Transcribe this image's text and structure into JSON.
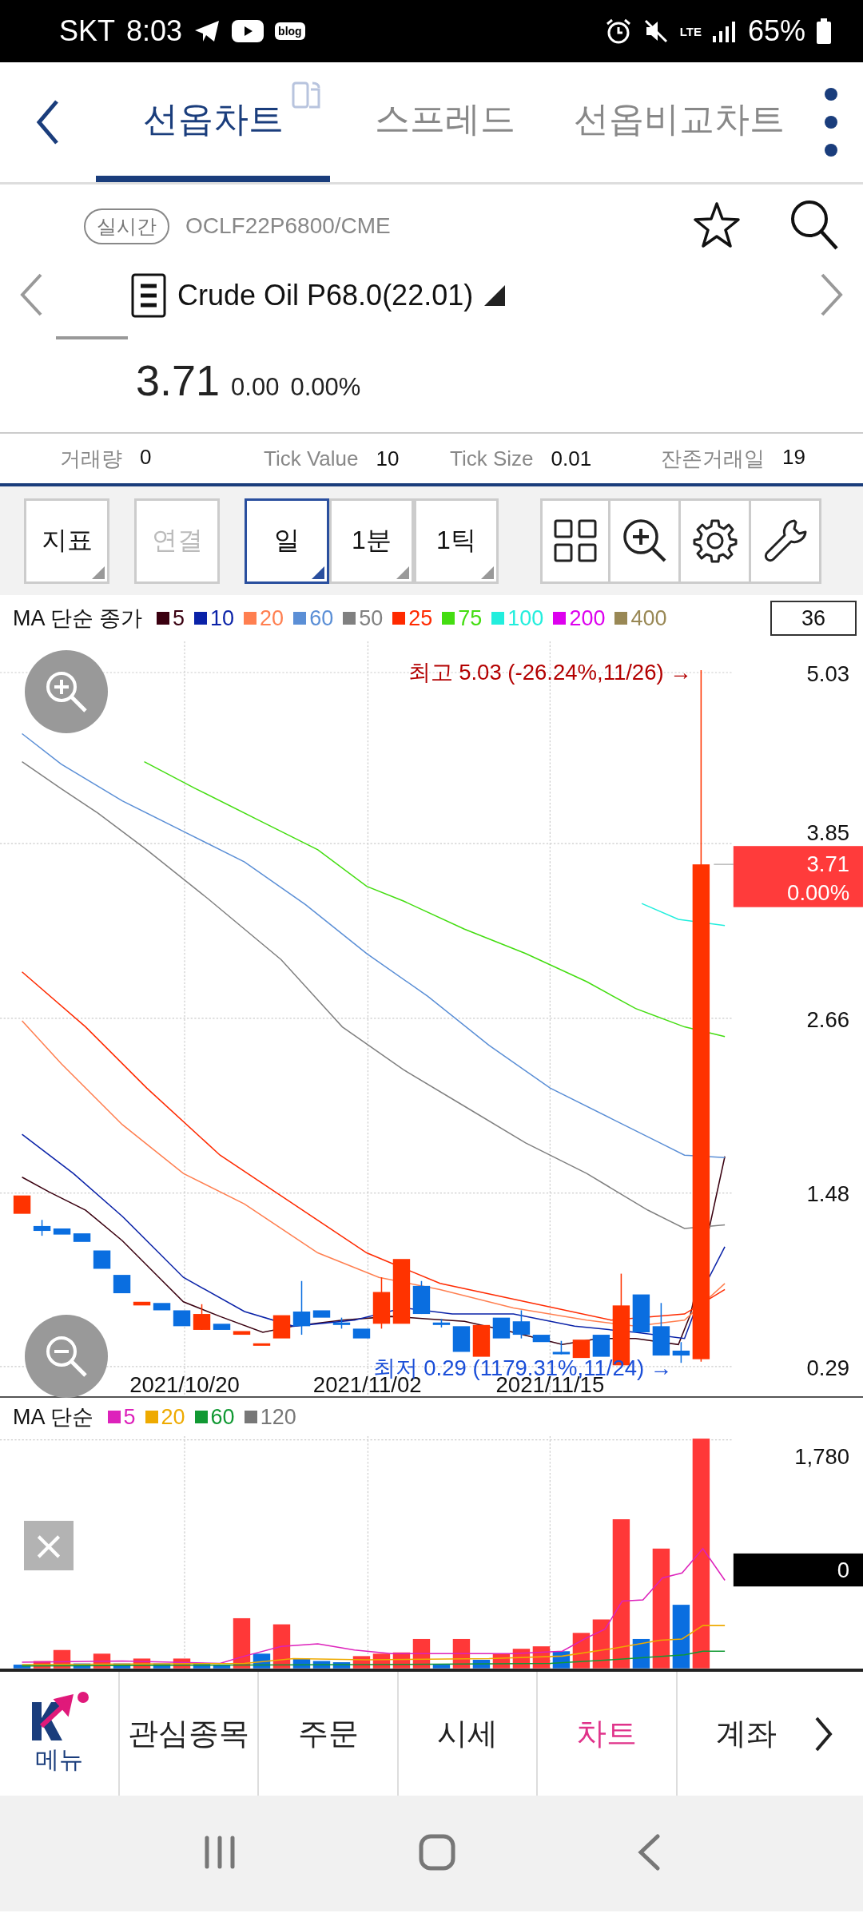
{
  "status_bar": {
    "carrier": "SKT",
    "time": "8:03",
    "blog_badge": "blog",
    "network": "LTE",
    "battery": "65%"
  },
  "tabs": [
    {
      "label": "선옵차트",
      "selected": true
    },
    {
      "label": "스프레드",
      "selected": false
    },
    {
      "label": "선옵비교차트",
      "selected": false
    }
  ],
  "instrument": {
    "badge": "실시간",
    "code": "OCLF22P6800/CME",
    "title": "Crude Oil P68.0(22.01)",
    "favorite": false,
    "price": "3.71",
    "change": "0.00",
    "change_rate": "0.00%"
  },
  "stats": [
    {
      "label": "거래량",
      "value": "0"
    },
    {
      "label": "Tick Value",
      "value": "10"
    },
    {
      "label": "Tick Size",
      "value": "0.01"
    },
    {
      "label": "잔존거래일",
      "value": "19"
    }
  ],
  "toolbar": {
    "buttons": [
      {
        "label": "지표",
        "disabled": false
      },
      {
        "label": "연결",
        "disabled": true
      }
    ],
    "periods": [
      {
        "label": "일",
        "selected": true
      },
      {
        "label": "1분",
        "selected": false
      },
      {
        "label": "1틱",
        "selected": false
      }
    ]
  },
  "price_chart": {
    "legend_title": "MA 단순 종가",
    "legend": [
      {
        "label": "5",
        "color": "#3a0010"
      },
      {
        "label": "10",
        "color": "#0a22a8"
      },
      {
        "label": "20",
        "color": "#ff7f50"
      },
      {
        "label": "60",
        "color": "#5b8fd6"
      },
      {
        "label": "50",
        "color": "#808080"
      },
      {
        "label": "25",
        "color": "#ff2a00"
      },
      {
        "label": "75",
        "color": "#44dd11"
      },
      {
        "label": "100",
        "color": "#22eedd"
      },
      {
        "label": "200",
        "color": "#dd00ee"
      },
      {
        "label": "400",
        "color": "#998855"
      }
    ],
    "count": "36",
    "y_labels": [
      "5.03",
      "3.85",
      "2.66",
      "1.48",
      "0.29"
    ],
    "x_labels": [
      "2021/10/20",
      "2021/11/02",
      "2021/11/15"
    ],
    "high_note": "최고 5.03 (-26.24%,11/26) →",
    "low_note": "최저 0.29 (1179.31%,11/24) →",
    "current_price": "3.71",
    "current_rate": "0.00%"
  },
  "volume_chart": {
    "legend_title": "MA 단순",
    "legend": [
      {
        "label": "5",
        "color": "#dd22bb"
      },
      {
        "label": "20",
        "color": "#eeaa00"
      },
      {
        "label": "60",
        "color": "#119933"
      },
      {
        "label": "120",
        "color": "#777777"
      }
    ],
    "y_label": "1,780",
    "current_value": "0",
    "close": "×"
  },
  "bottom_nav": {
    "menu_label": "메뉴",
    "items": [
      {
        "label": "관심종목",
        "selected": false
      },
      {
        "label": "주문",
        "selected": false
      },
      {
        "label": "시세",
        "selected": false
      },
      {
        "label": "차트",
        "selected": true
      },
      {
        "label": "계좌",
        "selected": false
      }
    ]
  }
}
